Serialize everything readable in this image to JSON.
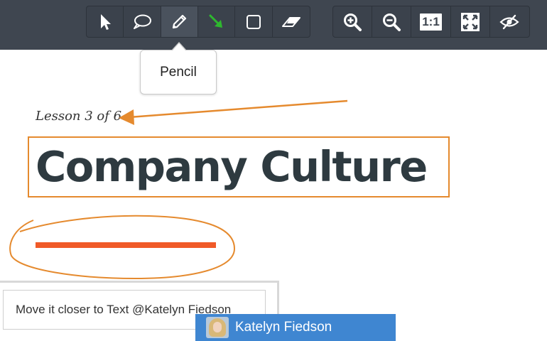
{
  "toolbar": {
    "draw_tools": [
      {
        "name": "pointer-tool",
        "icon": "cursor-arrow-icon"
      },
      {
        "name": "comment-tool",
        "icon": "speech-bubble-icon"
      },
      {
        "name": "pencil-tool",
        "icon": "pencil-icon",
        "active": true
      },
      {
        "name": "arrow-tool",
        "icon": "green-arrow-icon"
      },
      {
        "name": "rectangle-tool",
        "icon": "square-icon"
      },
      {
        "name": "eraser-tool",
        "icon": "eraser-icon"
      }
    ],
    "view_tools": [
      {
        "name": "zoom-in",
        "icon": "zoom-in-icon"
      },
      {
        "name": "zoom-out",
        "icon": "zoom-out-icon"
      },
      {
        "name": "actual-size",
        "icon": "one-to-one-icon",
        "label": "1:1"
      },
      {
        "name": "fit-screen",
        "icon": "expand-arrows-icon"
      },
      {
        "name": "toggle-visibility",
        "icon": "eye-slash-icon"
      }
    ]
  },
  "tooltip": {
    "text": "Pencil"
  },
  "lesson": {
    "label": "Lesson 3 of 6"
  },
  "page": {
    "title": "Company Culture"
  },
  "comment": {
    "value": "Move it closer to Text @Katelyn Fiedson"
  },
  "mention": {
    "name": "Katelyn Fiedson"
  },
  "colors": {
    "toolbar_bg": "#3f4650",
    "annotation": "#e58a2e",
    "accent_line": "#f05a28",
    "mention_bg": "#3f86d1",
    "arrow_tool": "#2eb82e"
  }
}
